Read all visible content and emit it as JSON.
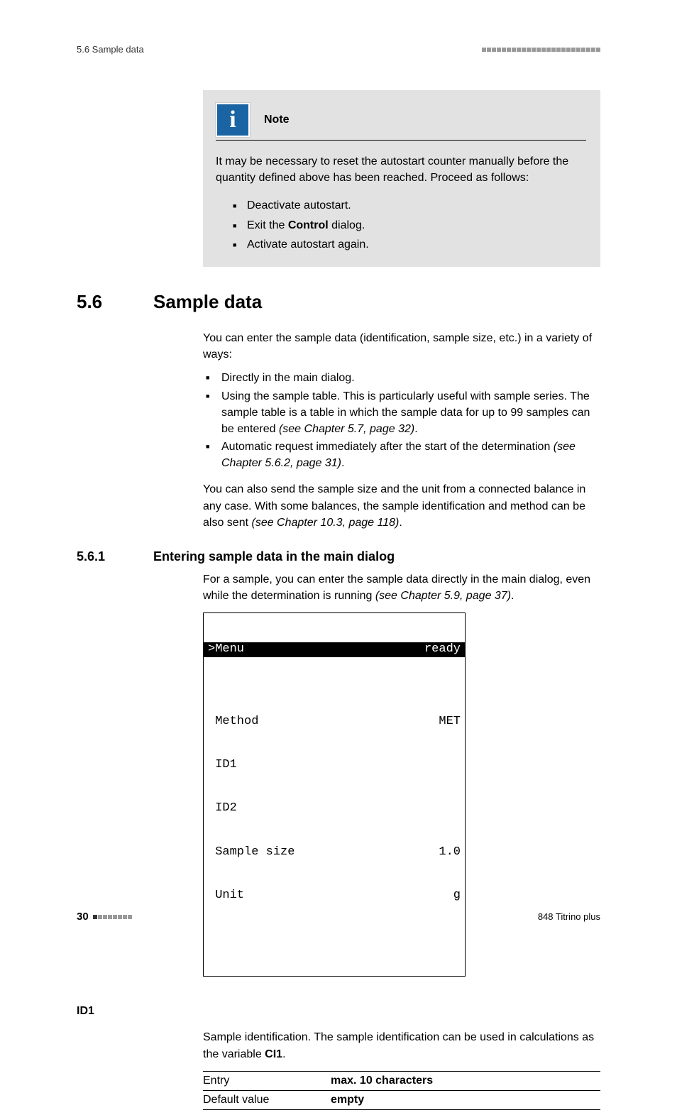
{
  "header": {
    "left": "5.6 Sample data"
  },
  "note": {
    "title": "Note",
    "body": "It may be necessary to reset the autostart counter manually before the quantity defined above has been reached. Proceed as follows:",
    "items_pre": [
      "Deactivate autostart.",
      "Exit the "
    ],
    "items_bold": "Control",
    "items_post": " dialog.",
    "item3": "Activate autostart again."
  },
  "section": {
    "num": "5.6",
    "title": "Sample data",
    "intro": "You can enter the sample data (identification, sample size, etc.) in a variety of ways:",
    "li1": "Directly in the main dialog.",
    "li2a": "Using the sample table. This is particularly useful with sample series. The sample table is a table in which the sample data for up to 99 samples can be entered ",
    "li2b": "(see Chapter 5.7, page 32)",
    "li2c": ".",
    "li3a": "Automatic request immediately after the start of the determination ",
    "li3b": "(see Chapter 5.6.2, page 31)",
    "li3c": ".",
    "para2a": "You can also send the sample size and the unit from a connected balance in any case. With some balances, the sample identification and method can be also sent ",
    "para2b": "(see Chapter 10.3, page 118)",
    "para2c": "."
  },
  "subsection": {
    "num": "5.6.1",
    "title": "Entering sample data in the main dialog",
    "body_a": "For a sample, you can enter the sample data directly in the main dialog, even while the determination is running ",
    "body_b": "(see Chapter 5.9, page 37)",
    "body_c": "."
  },
  "lcd": {
    "top_left": ">Menu",
    "top_right": "ready",
    "rows": [
      {
        "l": " Method",
        "r": "MET"
      },
      {
        "l": " ID1",
        "r": ""
      },
      {
        "l": " ID2",
        "r": ""
      },
      {
        "l": " Sample size",
        "r": "1.0"
      },
      {
        "l": " Unit",
        "r": "g"
      }
    ]
  },
  "param": {
    "label": "ID1",
    "desc_a": "Sample identification. The sample identification can be used in calculations as the variable ",
    "desc_bold": "CI1",
    "desc_c": ".",
    "rows": [
      {
        "key": "Entry",
        "val": "max. 10 characters"
      },
      {
        "key": "Default value",
        "val": "empty"
      }
    ]
  },
  "footer": {
    "page": "30",
    "device": "848 Titrino plus"
  }
}
